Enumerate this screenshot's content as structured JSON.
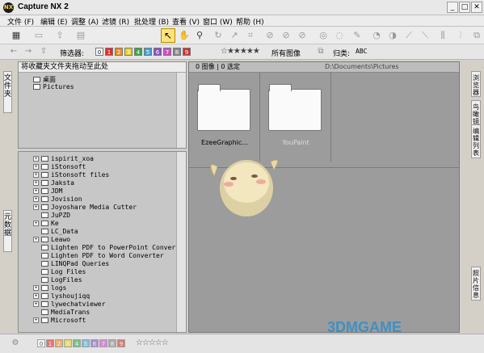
{
  "window": {
    "title": "Capture NX 2",
    "minimize": "_",
    "maximize": "□",
    "close": "✕"
  },
  "menu": [
    "文件 (F)",
    "编辑 (E)",
    "调整 (A)",
    "滤镜 (R)",
    "批处理 (B)",
    "查看 (V)",
    "窗口 (W)",
    "帮助 (H)"
  ],
  "toolbar2": {
    "filter_label": "筛选器:",
    "label_boxes": [
      "0",
      "1",
      "2",
      "3",
      "4",
      "5",
      "6",
      "7",
      "8",
      "9"
    ],
    "label_colors": [
      "#ffffff",
      "#e52b2b",
      "#f08c1c",
      "#e9d21d",
      "#35a845",
      "#3ea5d8",
      "#8a51c4",
      "#d04ec8",
      "#888888",
      "#cc3333"
    ],
    "stars": "☆★★★★★",
    "all_images": "所有图像",
    "sort_label": "归类:",
    "sort_value": "ABC"
  },
  "left_tabs": {
    "folders": "文件夹",
    "metadata": "元数据"
  },
  "folder_pane": {
    "header": "将收藏夹文件夹拖动至此处",
    "items": [
      "桌面",
      "Pictures"
    ]
  },
  "tree": {
    "items": [
      {
        "label": "ispirit_xoa",
        "exp": true
      },
      {
        "label": "iStonsoft",
        "exp": true
      },
      {
        "label": "iStonsoft files",
        "exp": true
      },
      {
        "label": "Jaksta",
        "exp": true
      },
      {
        "label": "JDM",
        "exp": true
      },
      {
        "label": "Jovision",
        "exp": true
      },
      {
        "label": "Joyoshare Media Cutter",
        "exp": true
      },
      {
        "label": "JuPZD",
        "exp": false
      },
      {
        "label": "Ke",
        "exp": true
      },
      {
        "label": "LC_Data",
        "exp": false
      },
      {
        "label": "Leawo",
        "exp": true
      },
      {
        "label": "Lighten PDF to PowerPoint Converter",
        "exp": false
      },
      {
        "label": "Lighten PDF to Word Converter",
        "exp": false
      },
      {
        "label": "LINQPad Queries",
        "exp": false
      },
      {
        "label": "Log Files",
        "exp": false
      },
      {
        "label": "LogFiles",
        "exp": false
      },
      {
        "label": "logs",
        "exp": true
      },
      {
        "label": "lyshoujiqq",
        "exp": true
      },
      {
        "label": "lywechatviewer",
        "exp": true
      },
      {
        "label": "MediaTrans",
        "exp": false
      },
      {
        "label": "Microsoft",
        "exp": true
      }
    ]
  },
  "browser": {
    "counts": "0 图像 | 0 选定",
    "path": "D:\\Documents\\Pictures",
    "thumbs": [
      "EzeeGraphic...",
      "YouPaint"
    ]
  },
  "right_tabs": {
    "browser": "浏览器",
    "birdseye": "鸟瞰镜头",
    "edit_list": "编辑列表",
    "photo_info": "照片信息"
  },
  "statusbar": {
    "label_boxes": [
      "0",
      "1",
      "2",
      "3",
      "4",
      "5",
      "6",
      "7",
      "8",
      "9"
    ],
    "stars": "☆☆☆☆☆"
  },
  "watermark": "3DMGAME"
}
